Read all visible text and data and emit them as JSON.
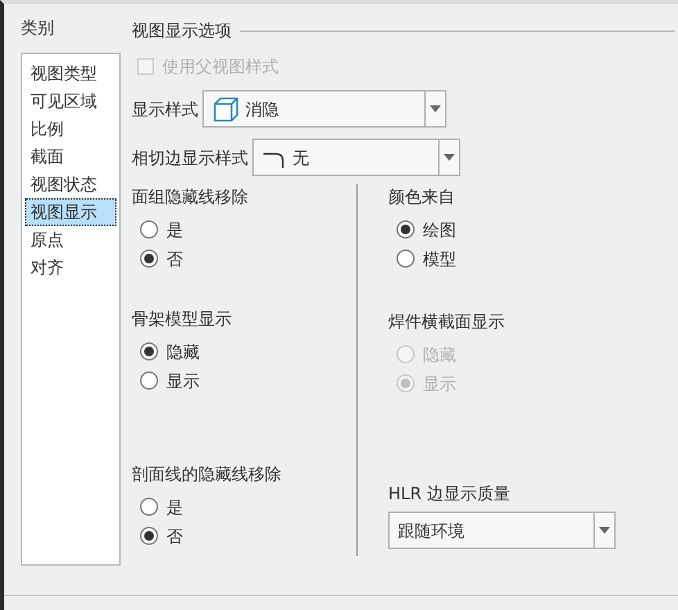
{
  "category_label": "类别",
  "categories": [
    {
      "label": "视图类型",
      "selected": false
    },
    {
      "label": "可见区域",
      "selected": false
    },
    {
      "label": "比例",
      "selected": false
    },
    {
      "label": "截面",
      "selected": false
    },
    {
      "label": "视图状态",
      "selected": false
    },
    {
      "label": "视图显示",
      "selected": true
    },
    {
      "label": "原点",
      "selected": false
    },
    {
      "label": "对齐",
      "selected": false
    }
  ],
  "section_title": "视图显示选项",
  "use_parent_style": {
    "label": "使用父视图样式",
    "checked": false,
    "disabled": true
  },
  "display_style": {
    "label": "显示样式",
    "value": "消隐"
  },
  "tangent_style": {
    "label": "相切边显示样式",
    "value": "无"
  },
  "left_groups": [
    {
      "title": "面组隐藏线移除",
      "disabled": false,
      "options": [
        {
          "label": "是",
          "selected": false
        },
        {
          "label": "否",
          "selected": true
        }
      ]
    },
    {
      "title": "骨架模型显示",
      "disabled": false,
      "options": [
        {
          "label": "隐藏",
          "selected": true
        },
        {
          "label": "显示",
          "selected": false
        }
      ]
    },
    {
      "title": "剖面线的隐藏线移除",
      "disabled": false,
      "options": [
        {
          "label": "是",
          "selected": false
        },
        {
          "label": "否",
          "selected": true
        }
      ]
    }
  ],
  "right_groups": [
    {
      "title": "颜色来自",
      "disabled": false,
      "options": [
        {
          "label": "绘图",
          "selected": true
        },
        {
          "label": "模型",
          "selected": false
        }
      ]
    },
    {
      "title": "焊件横截面显示",
      "disabled": true,
      "options": [
        {
          "label": "隐藏",
          "selected": false
        },
        {
          "label": "显示",
          "selected": true
        }
      ]
    }
  ],
  "hlr_quality": {
    "label": "HLR 边显示质量",
    "value": "跟随环境"
  }
}
